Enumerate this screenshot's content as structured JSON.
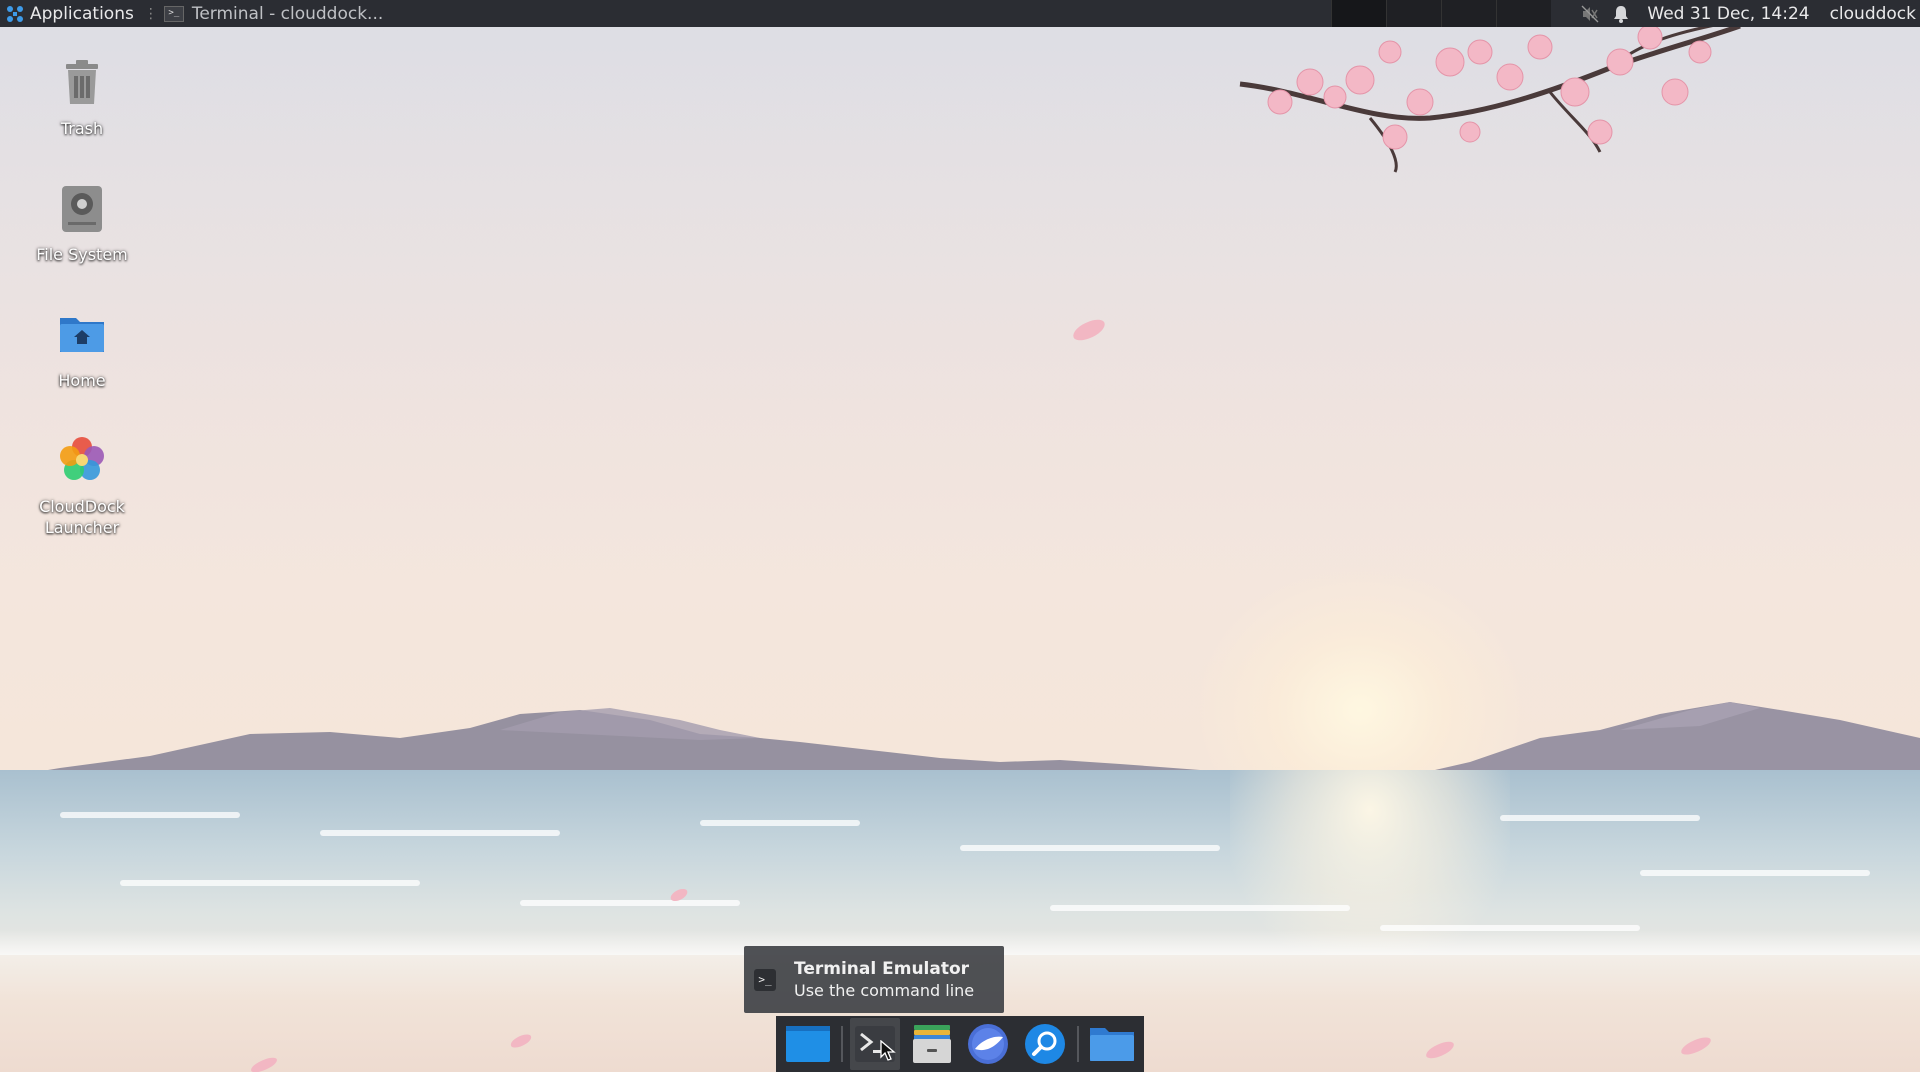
{
  "top_panel": {
    "applications_label": "Applications",
    "window_task_label": "Terminal - clouddock...",
    "clock": "Wed 31 Dec, 14:24",
    "user": "clouddock"
  },
  "desktop_icons": [
    {
      "label": "Trash",
      "icon": "trash-icon"
    },
    {
      "label": "File System",
      "icon": "drive-icon"
    },
    {
      "label": "Home",
      "icon": "home-folder-icon"
    },
    {
      "label": "CloudDock Launcher",
      "label_line1": "CloudDock",
      "label_line2": "Launcher",
      "icon": "launcher-flower-icon"
    }
  ],
  "tooltip": {
    "title": "Terminal Emulator",
    "description": "Use the command line"
  },
  "dock": {
    "items": [
      {
        "name": "show-desktop",
        "icon": "desktop-icon"
      },
      {
        "name": "terminal",
        "icon": "terminal-icon"
      },
      {
        "name": "file-manager",
        "icon": "file-cabinet-icon"
      },
      {
        "name": "web-browser",
        "icon": "browser-icon"
      },
      {
        "name": "app-finder",
        "icon": "search-icon"
      },
      {
        "name": "folder",
        "icon": "folder-icon"
      }
    ]
  },
  "colors": {
    "panel_bg": "#2b2d33",
    "dock_bg": "#2c2e33",
    "tooltip_bg": "#424448",
    "folder_blue": "#3d8fe0",
    "accent_blue": "#1f8fe6"
  }
}
